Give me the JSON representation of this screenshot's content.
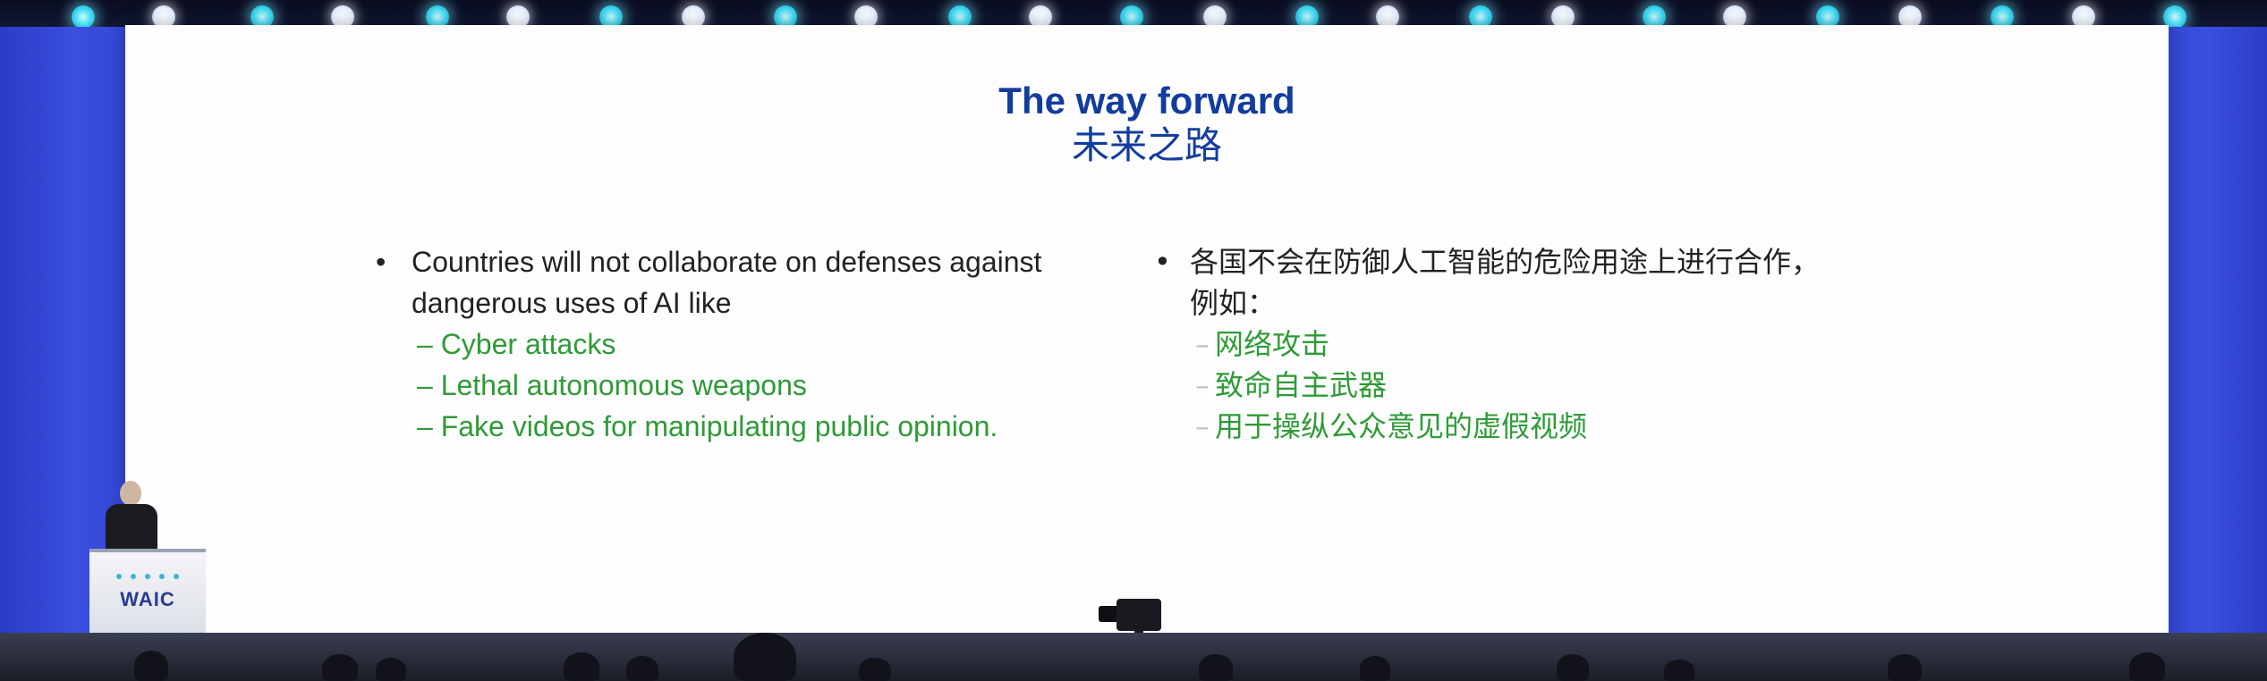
{
  "slide": {
    "title": "The way forward",
    "title_zh": "未来之路",
    "left_column": {
      "bullet": "•",
      "main_lines": [
        "Countries will not collaborate on defenses against",
        "dangerous uses of AI like"
      ],
      "sub_items": [
        "– Cyber attacks",
        "– Lethal autonomous weapons",
        "– Fake videos for manipulating public opinion."
      ]
    },
    "right_column": {
      "bullet": "•",
      "main_lines": [
        "各国不会在防御人工智能的危险用途上进行合作，",
        "例如："
      ],
      "sub_dash": "–",
      "sub_items": [
        "网络攻击",
        "致命自主武器",
        "用于操纵公众意见的虚假视频"
      ]
    },
    "colors": {
      "title": "#123c9e",
      "sub_items": "#2e9b36",
      "body_text": "#222222"
    }
  },
  "venue": {
    "podium_logo": "WAIC",
    "stage_lights": [
      "cyan",
      "white"
    ]
  }
}
